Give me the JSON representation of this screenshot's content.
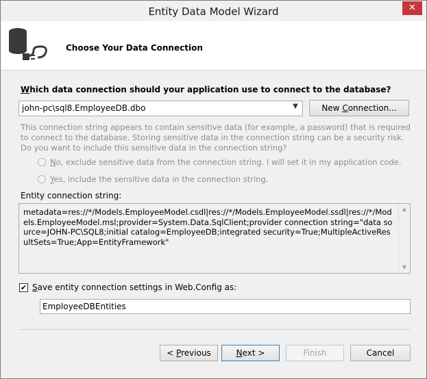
{
  "window": {
    "title": "Entity Data Model Wizard",
    "close_glyph": "✕"
  },
  "header": {
    "heading": "Choose Your Data Connection",
    "icon": "database-plug-icon"
  },
  "question": {
    "first": "W",
    "rest": "hich data connection should your application use to connect to the database?"
  },
  "connection_select": {
    "value": "john-pc\\sql8.EmployeeDB.dbo"
  },
  "new_connection_button": {
    "pre": "New ",
    "key": "C",
    "post": "onnection..."
  },
  "warning_text": "This connection string appears to contain sensitive data (for example, a password) that is required to connect to the database. Storing sensitive data in the connection string can be a security risk. Do you want to include this sensitive data in the connection string?",
  "radio_exclude": {
    "key": "N",
    "rest": "o, exclude sensitive data from the connection string. I will set it in my application code."
  },
  "radio_include": {
    "key": "Y",
    "rest": "es, include the sensitive data in the connection string."
  },
  "connection_string": {
    "label": "Entity connection string:",
    "value": "metadata=res://*/Models.EmployeeModel.csdl|res://*/Models.EmployeeModel.ssdl|res://*/Models.EmployeeModel.msl;provider=System.Data.SqlClient;provider connection string=\"data source=JOHN-PC\\SQL8;initial catalog=EmployeeDB;integrated security=True;MultipleActiveResultSets=True;App=EntityFramework\""
  },
  "save_settings": {
    "checked": true,
    "check_glyph": "✔",
    "key": "S",
    "rest": "ave entity connection settings in Web.Config as:"
  },
  "entities_name": {
    "value": "EmployeeDBEntities"
  },
  "buttons": {
    "previous": {
      "pre": "< ",
      "key": "P",
      "post": "revious"
    },
    "next": {
      "key": "N",
      "post": "ext >"
    },
    "finish": "Finish",
    "cancel": "Cancel"
  }
}
